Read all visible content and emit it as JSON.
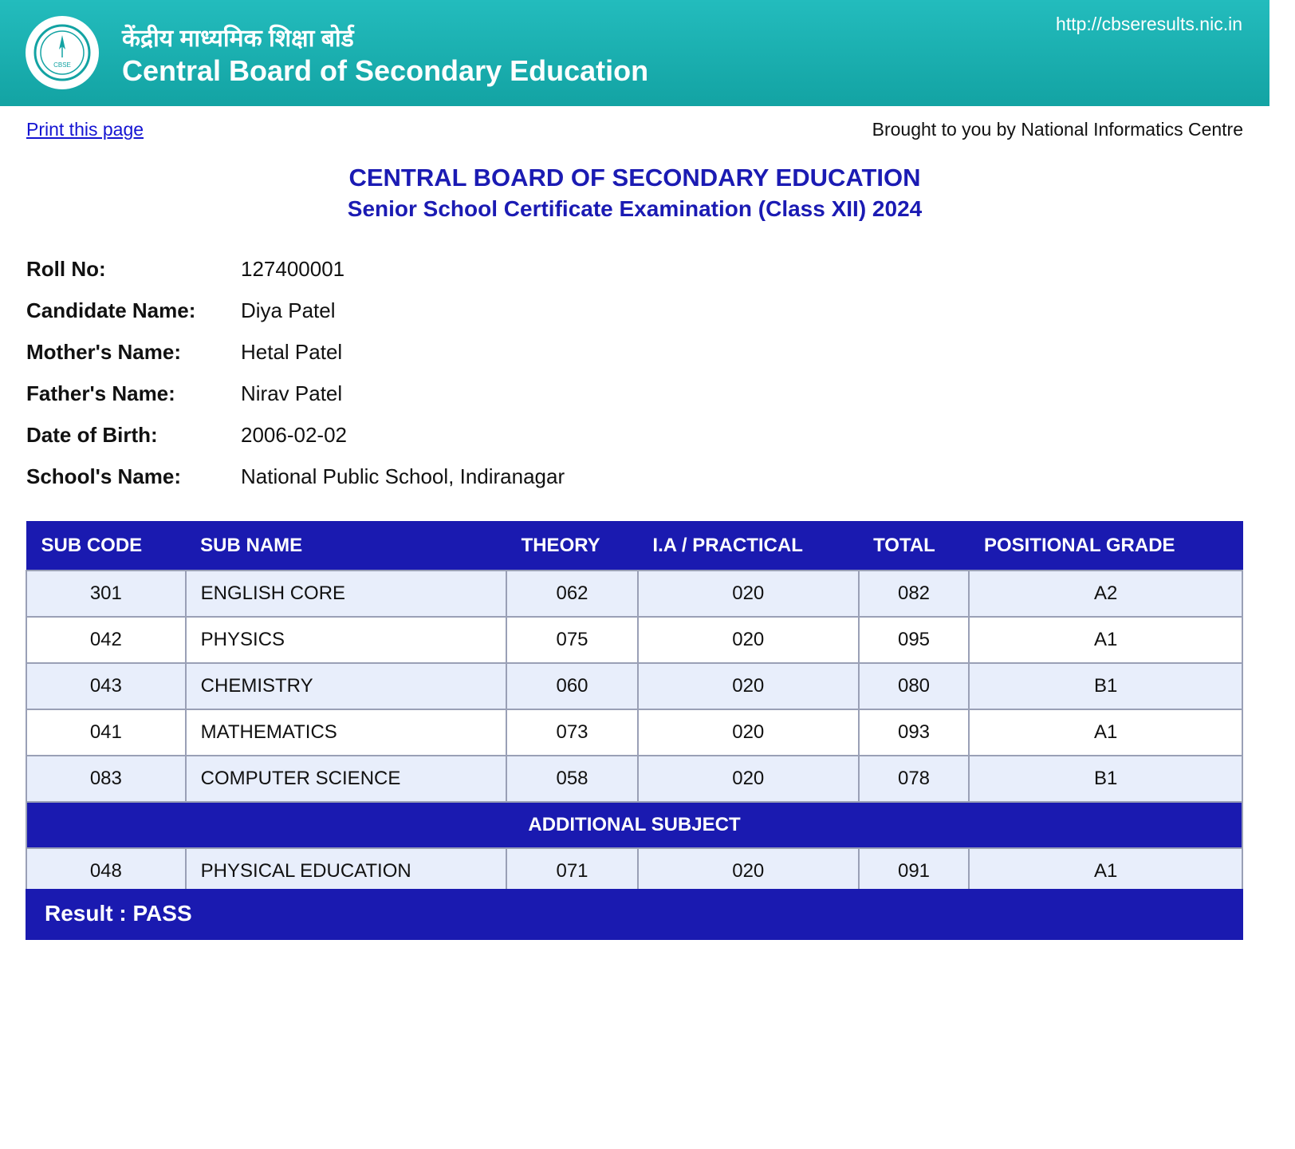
{
  "header": {
    "logo_text": "CBSE",
    "hindi_title": "केंद्रीय माध्यमिक शिक्षा बोर्ड",
    "english_title": "Central Board of Secondary Education",
    "url": "http://cbseresults.nic.in"
  },
  "toolbar": {
    "print_label": "Print this page",
    "credit": "Brought to you by National Informatics Centre"
  },
  "titles": {
    "board": "CENTRAL BOARD OF SECONDARY EDUCATION",
    "exam": "Senior School Certificate Examination (Class XII) 2024"
  },
  "candidate": [
    {
      "label": "Roll No:",
      "value": "127400001"
    },
    {
      "label": "Candidate Name:",
      "value": "Diya Patel"
    },
    {
      "label": "Mother's Name:",
      "value": "Hetal Patel"
    },
    {
      "label": "Father's Name:",
      "value": "Nirav Patel"
    },
    {
      "label": "Date of Birth:",
      "value": "2006-02-02"
    },
    {
      "label": "School's Name:",
      "value": "National Public School, Indiranagar"
    }
  ],
  "table": {
    "columns": [
      "SUB CODE",
      "SUB NAME",
      "THEORY",
      "I.A / PRACTICAL",
      "TOTAL",
      "POSITIONAL GRADE"
    ],
    "rows": [
      [
        "301",
        "ENGLISH CORE",
        "062",
        "020",
        "082",
        "A2"
      ],
      [
        "042",
        "PHYSICS",
        "075",
        "020",
        "095",
        "A1"
      ],
      [
        "043",
        "CHEMISTRY",
        "060",
        "020",
        "080",
        "B1"
      ],
      [
        "041",
        "MATHEMATICS",
        "073",
        "020",
        "093",
        "A1"
      ],
      [
        "083",
        "COMPUTER SCIENCE",
        "058",
        "020",
        "078",
        "B1"
      ]
    ],
    "additional_label": "ADDITIONAL SUBJECT",
    "additional_rows": [
      [
        "048",
        "PHYSICAL EDUCATION",
        "071",
        "020",
        "091",
        "A1"
      ]
    ]
  },
  "result": {
    "text": "Result : PASS"
  },
  "colors": {
    "banner": "#1fb3b3",
    "navy": "#1a1ab0",
    "heading": "#1b1bb3",
    "link": "#1414d2",
    "row_alt": "#e8eefb"
  }
}
